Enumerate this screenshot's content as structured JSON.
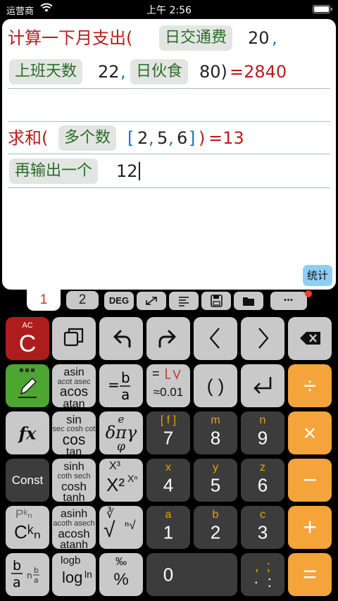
{
  "status_bar": {
    "carrier": "运营商",
    "time": "上午 2:56"
  },
  "document": {
    "line1": {
      "text": "计算一下月支出(",
      "token_a": "日交通费",
      "value_a": "20",
      "comma": ","
    },
    "line2": {
      "token_a": "上班天数",
      "value_a": "22",
      "comma": ",",
      "token_b": "日伙食",
      "value_b": "80)",
      "result": "=2840"
    },
    "line3": {
      "text": ""
    },
    "line4": {
      "text": "求和(",
      "token": "多个数",
      "open_bracket": "[",
      "v1": "2",
      "c1": ",",
      "v2": "5",
      "c2": ",",
      "v3": "6",
      "close_bracket": "]",
      "close_paren": ")",
      "result": "=13"
    },
    "line5": {
      "token": "再输出一个",
      "input": "12"
    },
    "stats_button": "统计"
  },
  "toolbar": {
    "tabs": [
      "1",
      "2"
    ],
    "deg_label": "DEG",
    "more_label": "•••",
    "notification_color": "#ff3b30"
  },
  "keypad": {
    "row1": {
      "ac_small": "AC",
      "ac_main": "C"
    },
    "row2": {
      "trig1": {
        "top": "asin",
        "mid": "acot asec",
        "main": "acos",
        "bot": "atan"
      },
      "frac": "=b/a",
      "approx": {
        "top": "=",
        "mid": "≈0.01"
      },
      "parens": "( )",
      "divide": "÷"
    },
    "row3": {
      "fx": "fx",
      "trig2": {
        "top": "sin",
        "mid": "sec cosh cot",
        "main": "cos",
        "bot": "tan"
      },
      "greek": {
        "top": "e",
        "main": "δπγ",
        "bot": "φ"
      },
      "k7": {
        "main": "7",
        "sup": "[ f ]"
      },
      "k8": {
        "main": "8",
        "sup": "m"
      },
      "k9": {
        "main": "9",
        "sup": "n"
      },
      "multiply": "×"
    },
    "row4": {
      "const": "Const",
      "hyp1": {
        "top": "sinh",
        "mid": "coth sech",
        "main": "cosh",
        "bot": "tanh"
      },
      "power": {
        "top": "X³",
        "main": "X²",
        "sup": "Xⁿ"
      },
      "k4": {
        "main": "4",
        "sup": "x"
      },
      "k5": {
        "main": "5",
        "sup": "y"
      },
      "k6": {
        "main": "6",
        "sup": "z"
      },
      "minus": "−"
    },
    "row5": {
      "perm": {
        "top": "Pᵏₙ",
        "main": "Cᵏₙ"
      },
      "hyp2": {
        "top": "asinh",
        "mid": "acoth asech",
        "main": "acosh",
        "bot": "atanh"
      },
      "root": {
        "top": "∛",
        "main": "√",
        "sup": "ⁿ√"
      },
      "k1": {
        "main": "1",
        "sup": "a"
      },
      "k2": {
        "main": "2",
        "sup": "b"
      },
      "k3": {
        "main": "3",
        "sup": "c"
      },
      "plus": "+"
    },
    "row6": {
      "mixed": {
        "main": "b/a",
        "side": "n b/a"
      },
      "log": {
        "top": "logb",
        "main": "log",
        "side": "ln"
      },
      "percent": {
        "top": "‰",
        "main": "%"
      },
      "k0": "0",
      "punct": {
        "top": ",  ;",
        "main": "·  :"
      },
      "equals": "="
    }
  },
  "colors": {
    "token_bg": "#e3e5e3",
    "token_text": "#2a6d27",
    "result_red": "#b81d1d",
    "bracket_blue": "#1e6fd1",
    "key_gray": "#c9c9c9",
    "key_dark": "#3c3c3c",
    "key_orange": "#f4a43b",
    "key_red": "#ae1d1d",
    "key_green": "#4ca631"
  }
}
